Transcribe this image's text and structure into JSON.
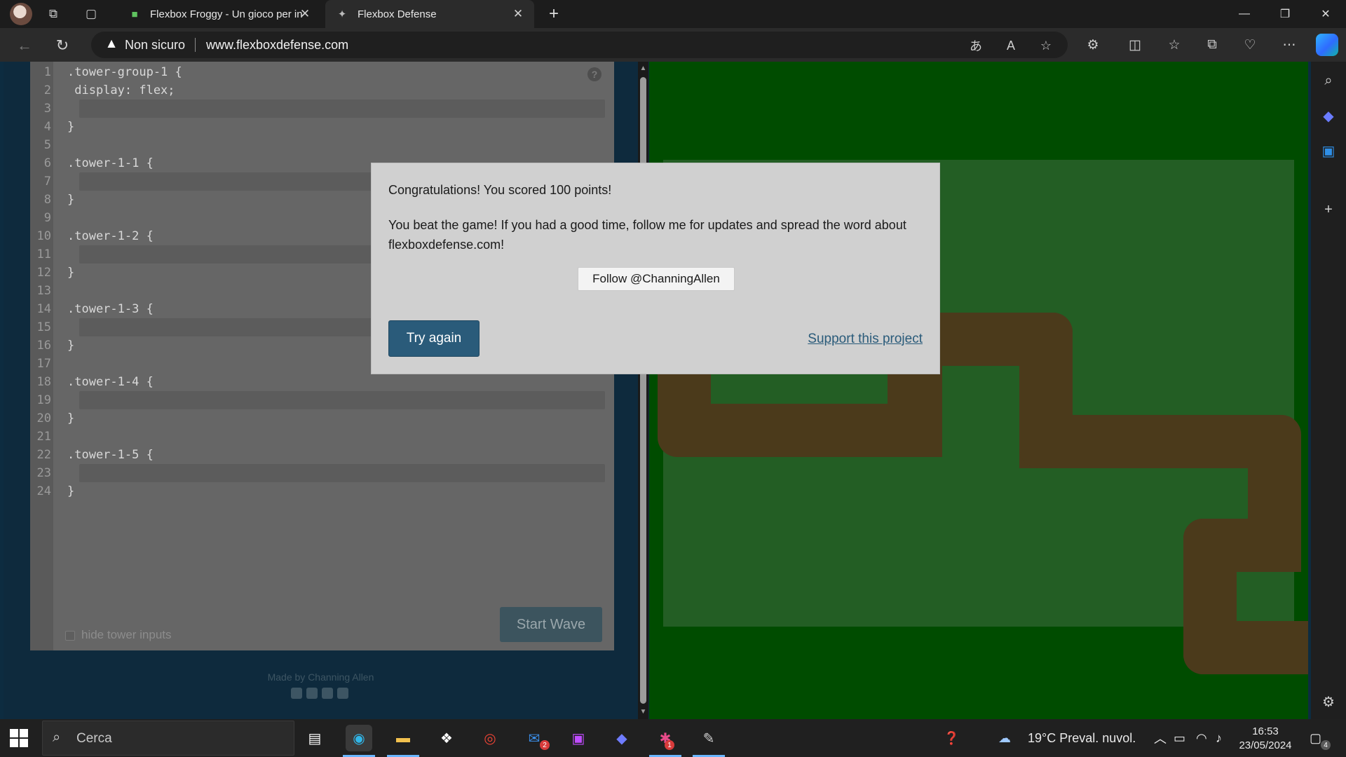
{
  "browser": {
    "tabs": [
      {
        "title": "Flexbox Froggy - Un gioco per in",
        "favicon": "frog-icon",
        "active": false
      },
      {
        "title": "Flexbox Defense",
        "favicon": "defense-icon",
        "active": true
      }
    ],
    "security_label": "Non sicuro",
    "url": "www.flexboxdefense.com"
  },
  "editor": {
    "line_numbers": [
      "1",
      "2",
      "3",
      "4",
      "5",
      "6",
      "7",
      "8",
      "9",
      "10",
      "11",
      "12",
      "13",
      "14",
      "15",
      "16",
      "17",
      "18",
      "19",
      "20",
      "21",
      "22",
      "23",
      "24"
    ],
    "lines": [
      {
        "n": 1,
        "text": ".tower-group-1 {"
      },
      {
        "n": 2,
        "text": " display: flex;"
      },
      {
        "n": 4,
        "text": "}"
      },
      {
        "n": 6,
        "text": ".tower-1-1 {"
      },
      {
        "n": 8,
        "text": "}"
      },
      {
        "n": 10,
        "text": ".tower-1-2 {"
      },
      {
        "n": 12,
        "text": "}"
      },
      {
        "n": 14,
        "text": ".tower-1-3 {"
      },
      {
        "n": 16,
        "text": "}"
      },
      {
        "n": 18,
        "text": ".tower-1-4 {"
      },
      {
        "n": 20,
        "text": "}"
      },
      {
        "n": 22,
        "text": ".tower-1-5 {"
      },
      {
        "n": 24,
        "text": "}"
      }
    ],
    "help_label": "?",
    "start_wave_label": "Start Wave",
    "hide_inputs_label": "hide tower inputs",
    "hide_inputs_checked": false,
    "made_by": "Made by Channing Allen"
  },
  "modal": {
    "title": "Congratulations! You scored 100 points!",
    "body": "You beat the game! If you had a good time, follow me for updates and spread the word about flexboxdefense.com!",
    "follow_label": "Follow @ChanningAllen",
    "try_again_label": "Try again",
    "support_label": "Support this project"
  },
  "colors": {
    "board": "#004c00",
    "field": "#235e24",
    "path": "#4b3a1b",
    "primary_button": "#2a5b7a"
  },
  "taskbar": {
    "search_placeholder": "Cerca",
    "weather": "19°C  Preval. nuvol.",
    "time": "16:53",
    "date": "23/05/2024",
    "mail_badge": "2",
    "app_badge": "1",
    "notification_count": "4"
  }
}
